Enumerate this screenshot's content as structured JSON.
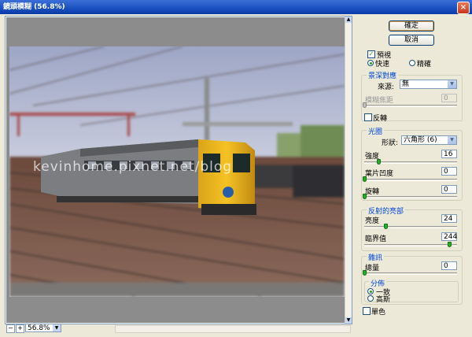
{
  "window": {
    "title": "鏡頭模糊 (56.8%)",
    "close_glyph": "×"
  },
  "buttons": {
    "ok": "確定",
    "cancel": "取消"
  },
  "preview": {
    "label": "預視",
    "checked": true,
    "mode_fast": "快速",
    "mode_accurate": "精確",
    "selected": "fast"
  },
  "depth_map": {
    "title": "景深對應",
    "source_label": "來源:",
    "source_value": "無",
    "blur_focal_label": "模糊焦距",
    "blur_focal_value": "0",
    "blur_focal_position": 0,
    "invert_label": "反轉",
    "invert_checked": false
  },
  "iris": {
    "title": "光圈",
    "shape_label": "形狀:",
    "shape_value": "六角形 (6)",
    "radius_label": "強度",
    "radius_value": "16",
    "radius_position": 0.16,
    "curvature_label": "葉片凹度",
    "curvature_value": "0",
    "curvature_position": 0,
    "rotation_label": "旋轉",
    "rotation_value": "0",
    "rotation_position": 0
  },
  "specular": {
    "title": "反射的亮部",
    "brightness_label": "亮度",
    "brightness_value": "24",
    "brightness_position": 0.24,
    "threshold_label": "臨界值",
    "threshold_value": "244",
    "threshold_position": 0.957
  },
  "noise": {
    "title": "雜訊",
    "amount_label": "總量",
    "amount_value": "0",
    "amount_position": 0,
    "distribution_title": "分佈",
    "uniform_label": "一致",
    "gaussian_label": "高斯",
    "distribution_selected": "uniform",
    "monochromatic_label": "單色",
    "monochromatic_checked": false
  },
  "status": {
    "zoom_value": "56.8%",
    "zoom_out": "−",
    "zoom_in": "+"
  },
  "image": {
    "watermark": "kevinhome.pixnet.net/blog"
  },
  "colors": {
    "accent_title": "#0046d5",
    "slider_thumb": "#1eb31e",
    "titlebar": "#1a4fbf"
  }
}
